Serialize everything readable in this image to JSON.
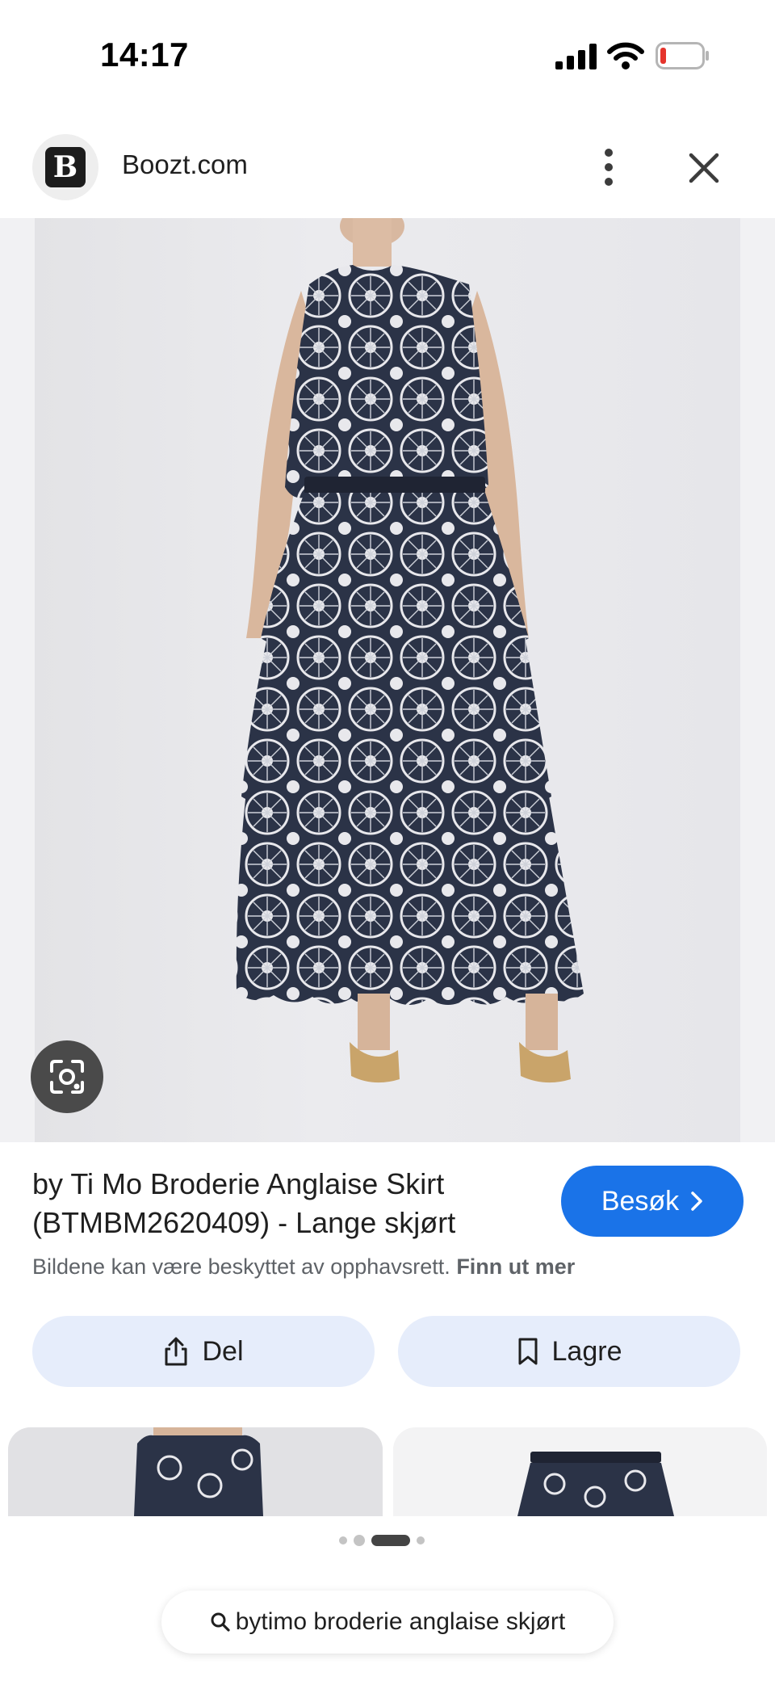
{
  "status_bar": {
    "time": "14:17"
  },
  "header": {
    "favicon_letter": "B",
    "site_name": "Boozt.com"
  },
  "result": {
    "title": "by Ti Mo Broderie Anglaise Skirt (BTMBM2620409) - Lange skjørt",
    "visit_label": "Besøk",
    "copyright_text": "Bildene kan være beskyttet av opphavsrett.",
    "learn_more_label": "Finn ut mer"
  },
  "actions": {
    "share_label": "Del",
    "save_label": "Lagre"
  },
  "search": {
    "query": "bytimo broderie anglaise skjørt"
  },
  "pager": {
    "count": 4,
    "active_index": 2
  },
  "colors": {
    "accent": "#1a73e8",
    "pill_bg": "#e6edfb",
    "fabric_navy": "#2b3347"
  },
  "icons": [
    "cellular-signal-icon",
    "wifi-icon",
    "battery-low-icon",
    "more-vert-icon",
    "close-icon",
    "google-lens-icon",
    "chevron-right-icon",
    "share-icon",
    "bookmark-icon",
    "search-icon"
  ]
}
